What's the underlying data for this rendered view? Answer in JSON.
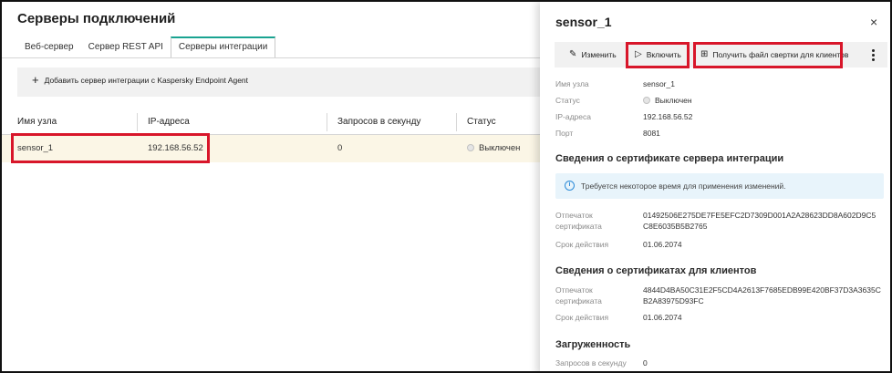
{
  "page": {
    "title": "Серверы подключений",
    "tabs": [
      {
        "label": "Веб-сервер"
      },
      {
        "label": "Сервер REST API"
      },
      {
        "label": "Серверы интеграции"
      }
    ],
    "add_button_label": "Добавить сервер интеграции с Kaspersky Endpoint Agent"
  },
  "table": {
    "columns": [
      "Имя узла",
      "IP-адреса",
      "Запросов в секунду",
      "Статус"
    ],
    "rows": [
      {
        "name": "sensor_1",
        "ip": "192.168.56.52",
        "rps": "0",
        "status": "Выключен"
      }
    ]
  },
  "panel": {
    "title": "sensor_1",
    "close": "×",
    "actions": {
      "edit": "Изменить",
      "enable": "Включить",
      "get_file": "Получить файл свертки для клиентов"
    },
    "details": [
      {
        "label": "Имя узла",
        "value": "sensor_1"
      },
      {
        "label": "Статус",
        "value": "Выключен"
      },
      {
        "label": "IP-адреса",
        "value": "192.168.56.52"
      },
      {
        "label": "Порт",
        "value": "8081"
      }
    ],
    "server_cert": {
      "heading": "Сведения о сертификате сервера интеграции",
      "info": "Требуется некоторое время для применения изменений.",
      "fingerprint_label_1": "Отпечаток",
      "fingerprint_label_2": "сертификата",
      "fingerprint_line_1": "01492506E275DE7FE5EFC2D7309D001A2A28623DD8A602D9C5",
      "fingerprint_line_2": "C8E6035B5B2765",
      "expiry_label": "Срок действия",
      "expiry_value": "01.06.2074"
    },
    "client_cert": {
      "heading": "Сведения о сертификатах для клиентов",
      "fingerprint_label_1": "Отпечаток",
      "fingerprint_label_2": "сертификата",
      "fingerprint_line_1": "4844D4BA50C31E2F5CD4A2613F7685EDB99E420BF37D3A3635C",
      "fingerprint_line_2": "B2A83975D93FC",
      "expiry_label": "Срок действия",
      "expiry_value": "01.06.2074"
    },
    "load": {
      "heading": "Загруженность",
      "rps_label": "Запросов в секунду",
      "rps_value": "0"
    }
  },
  "colors": {
    "highlight": "#d8162a",
    "active_tab_accent": "#19a391",
    "selected_row": "#fbf6e6",
    "info_bg": "#e8f4fb"
  }
}
